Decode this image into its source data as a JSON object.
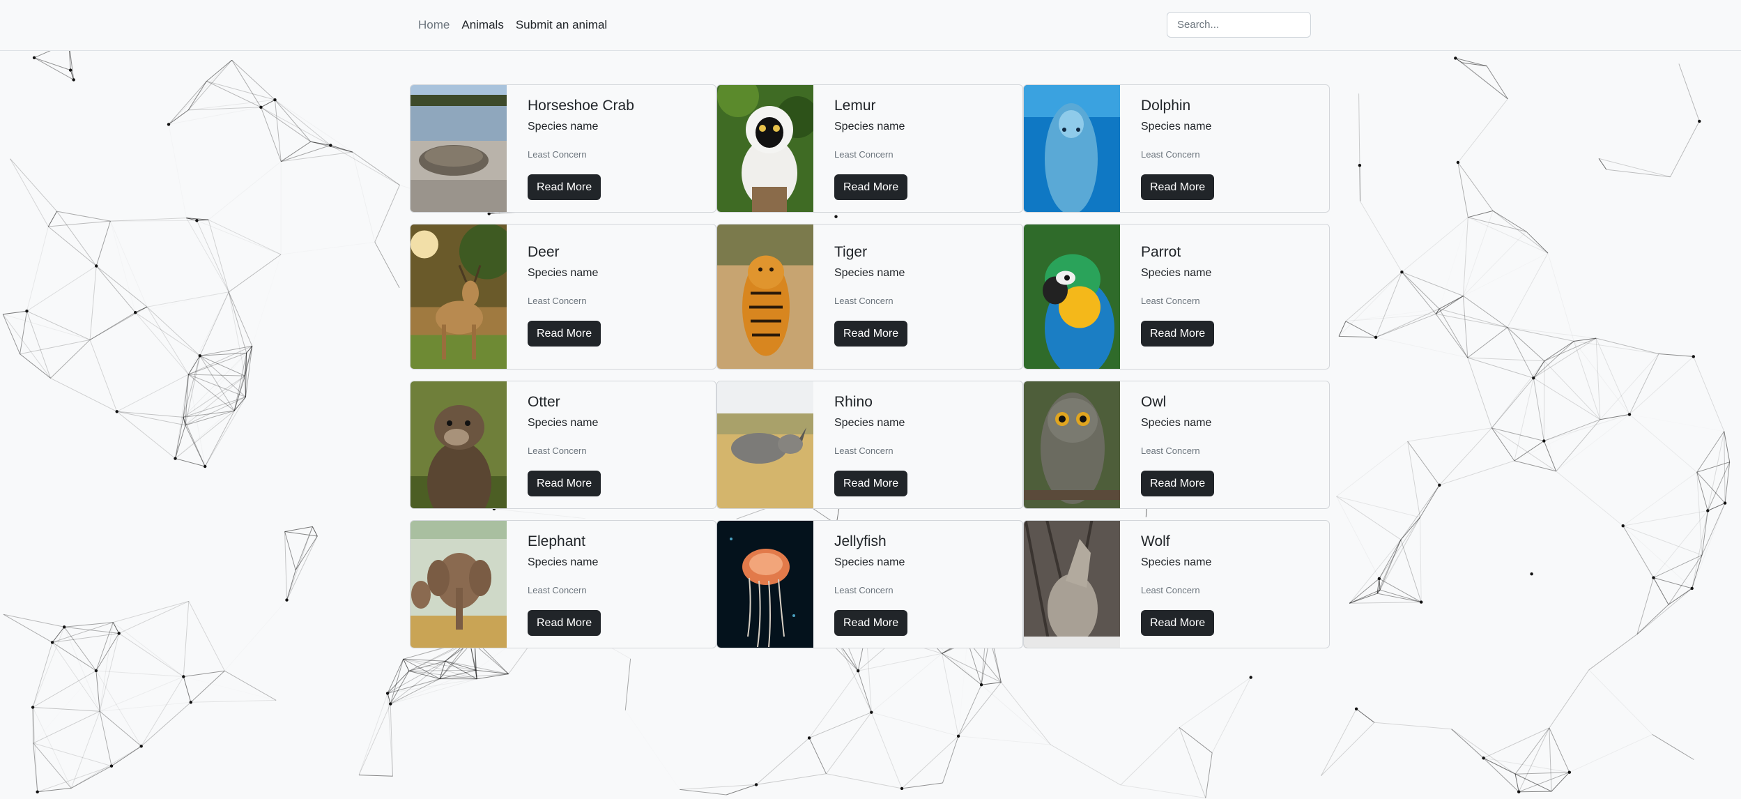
{
  "nav": {
    "links": [
      {
        "label": "Home",
        "active": true
      },
      {
        "label": "Animals",
        "active": false
      },
      {
        "label": "Submit an animal",
        "active": false
      }
    ],
    "search_placeholder": "Search..."
  },
  "colors": {
    "background": "#f8f9fa",
    "button": "#212529",
    "muted_text": "#6c757d",
    "border": "#d3d6da"
  },
  "animals": [
    {
      "name": "Horseshoe Crab",
      "subtitle": "Species name",
      "status": "Least Concern",
      "button": "Read More",
      "image": "horseshoe-crab-photo"
    },
    {
      "name": "Lemur",
      "subtitle": "Species name",
      "status": "Least Concern",
      "button": "Read More",
      "image": "lemur-photo"
    },
    {
      "name": "Dolphin",
      "subtitle": "Species name",
      "status": "Least Concern",
      "button": "Read More",
      "image": "dolphin-photo"
    },
    {
      "name": "Deer",
      "subtitle": "Species name",
      "status": "Least Concern",
      "button": "Read More",
      "image": "deer-photo"
    },
    {
      "name": "Tiger",
      "subtitle": "Species name",
      "status": "Least Concern",
      "button": "Read More",
      "image": "tiger-photo"
    },
    {
      "name": "Parrot",
      "subtitle": "Species name",
      "status": "Least Concern",
      "button": "Read More",
      "image": "parrot-photo"
    },
    {
      "name": "Otter",
      "subtitle": "Species name",
      "status": "Least Concern",
      "button": "Read More",
      "image": "otter-photo"
    },
    {
      "name": "Rhino",
      "subtitle": "Species name",
      "status": "Least Concern",
      "button": "Read More",
      "image": "rhino-photo"
    },
    {
      "name": "Owl",
      "subtitle": "Species name",
      "status": "Least Concern",
      "button": "Read More",
      "image": "owl-photo"
    },
    {
      "name": "Elephant",
      "subtitle": "Species name",
      "status": "Least Concern",
      "button": "Read More",
      "image": "elephant-photo"
    },
    {
      "name": "Jellyfish",
      "subtitle": "Species name",
      "status": "Least Concern",
      "button": "Read More",
      "image": "jellyfish-photo"
    },
    {
      "name": "Wolf",
      "subtitle": "Species name",
      "status": "Least Concern",
      "button": "Read More",
      "image": "wolf-photo"
    }
  ]
}
